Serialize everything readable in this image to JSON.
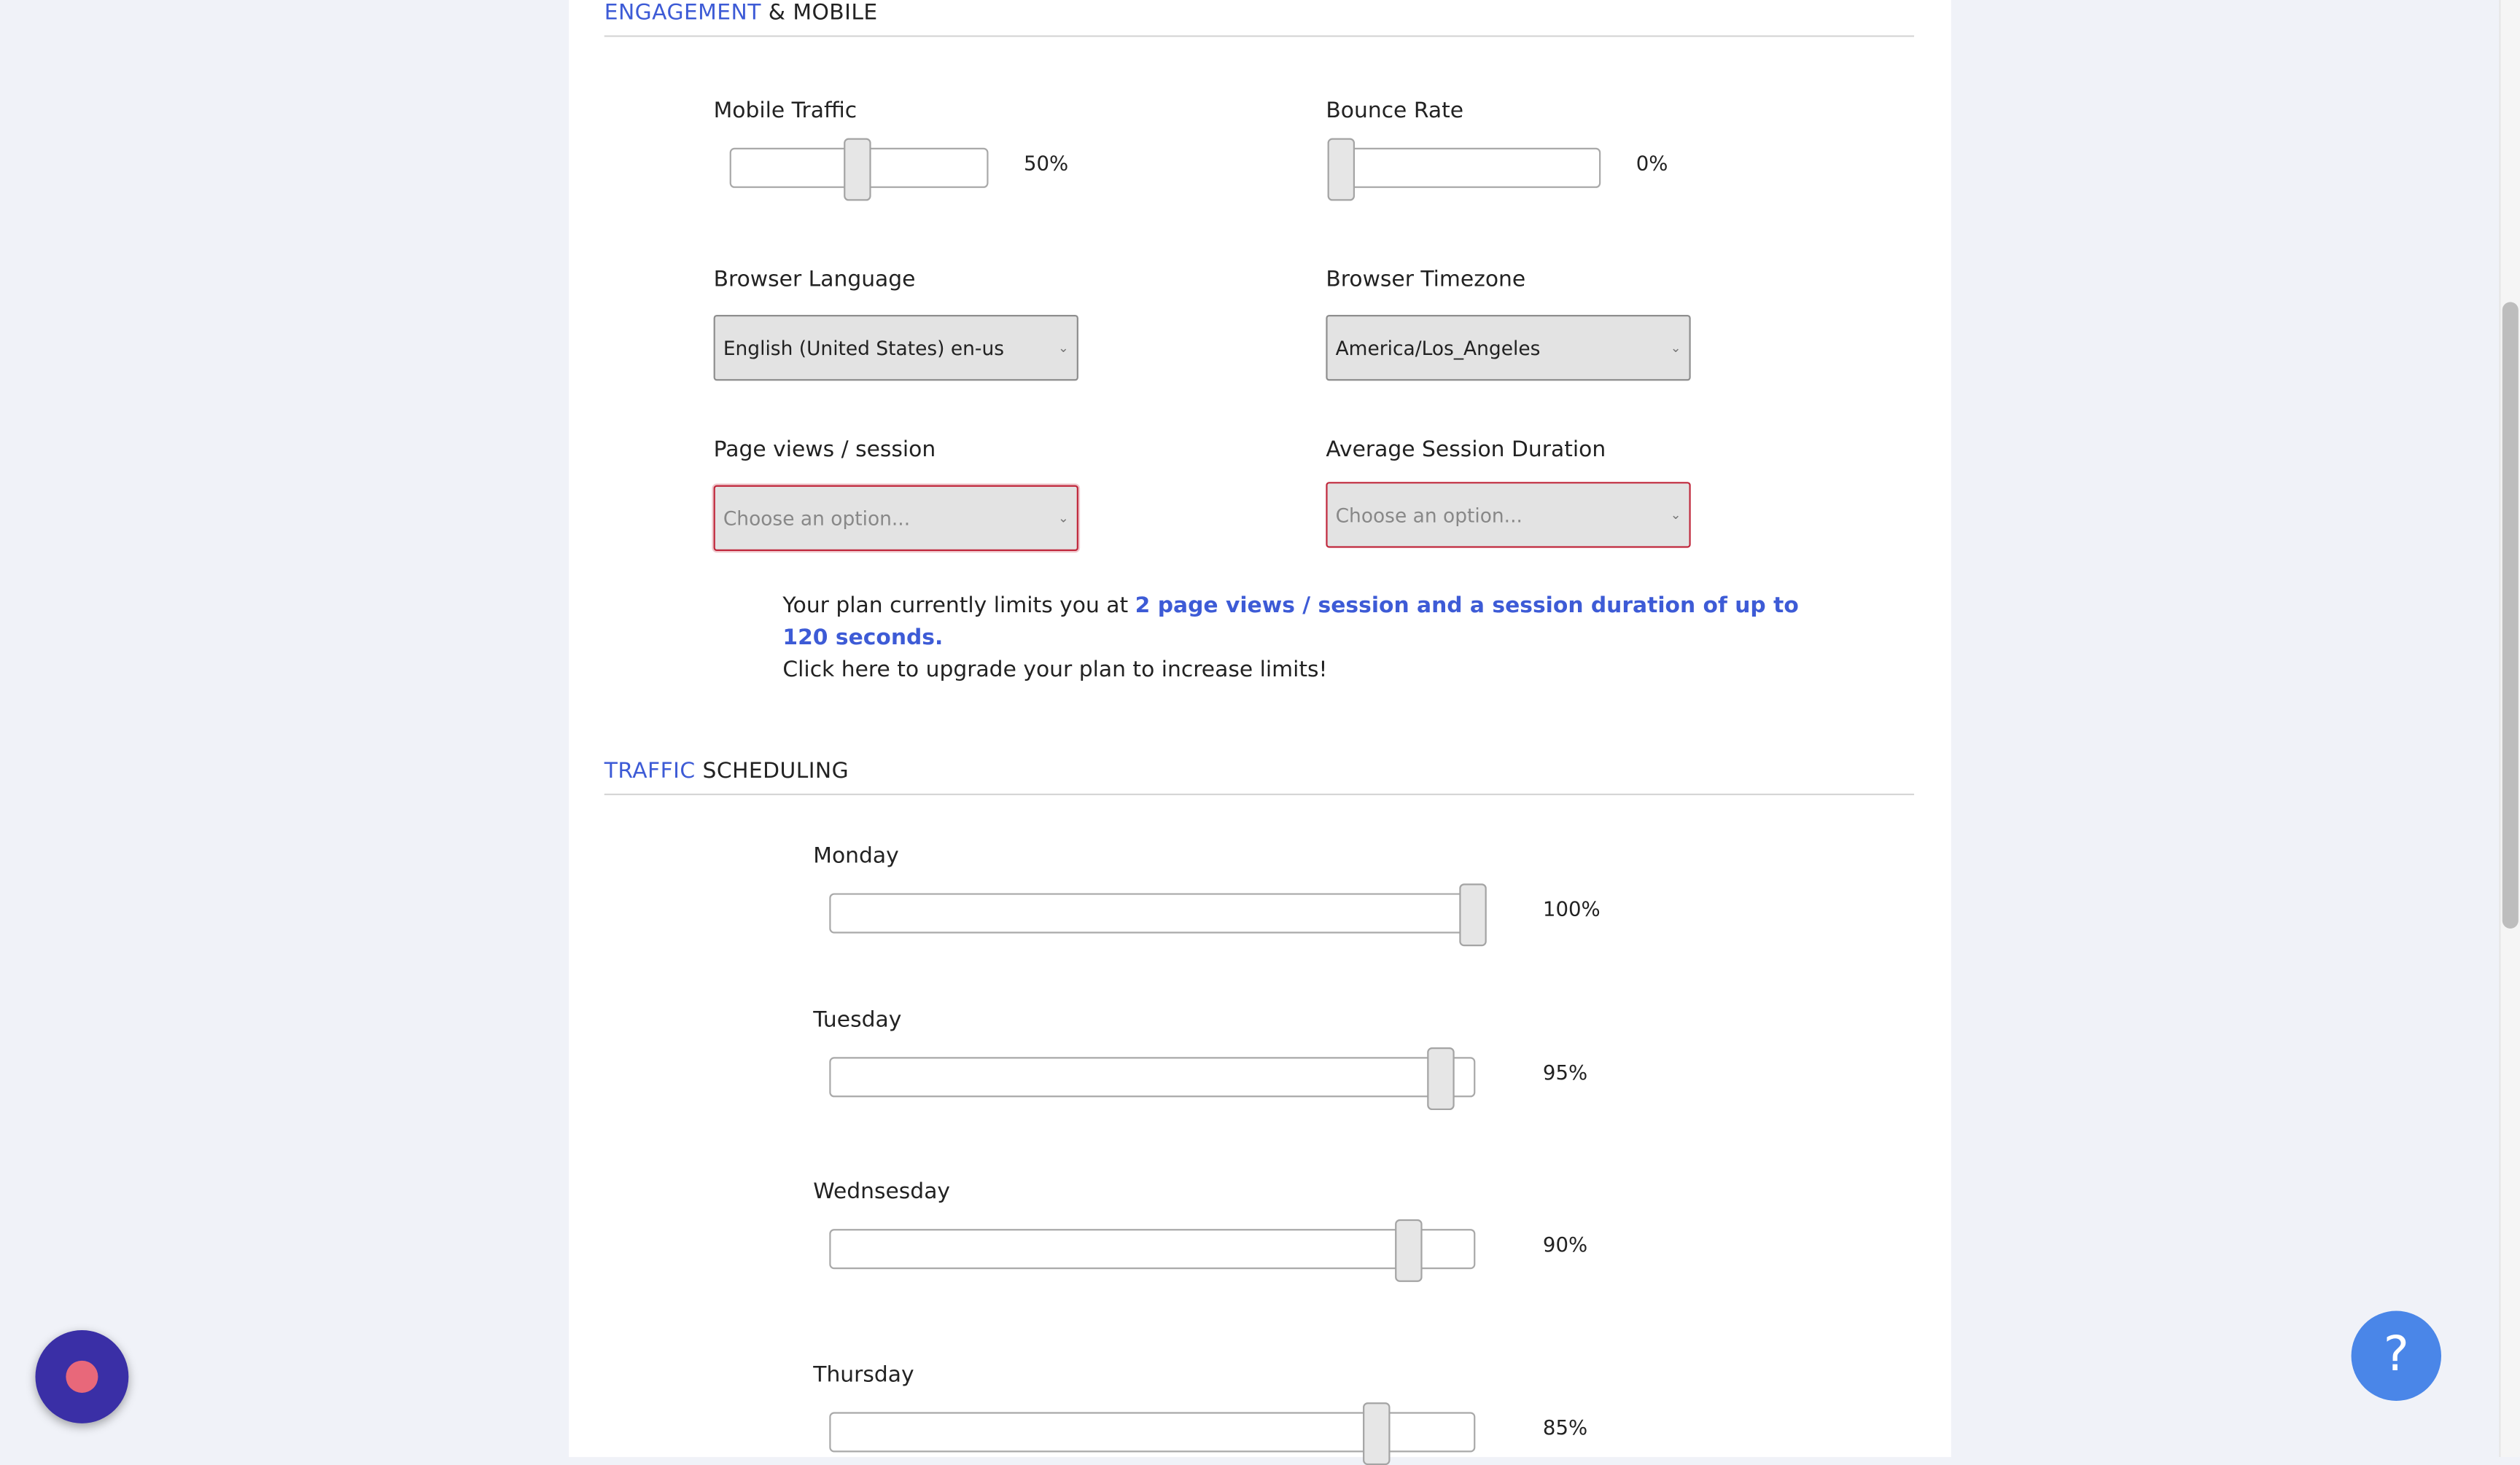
{
  "engagement": {
    "title_accent": "ENGAGEMENT",
    "title_rest": "& MOBILE",
    "mobile_traffic": {
      "label": "Mobile Traffic",
      "value": 0.5,
      "value_text": "50%"
    },
    "bounce_rate": {
      "label": "Bounce Rate",
      "value": 0.0,
      "value_text": "0%"
    },
    "browser_language": {
      "label": "Browser Language",
      "selected": "English (United States) en-us"
    },
    "browser_timezone": {
      "label": "Browser Timezone",
      "selected": "America/Los_Angeles"
    },
    "page_views": {
      "label": "Page views / session",
      "placeholder": "Choose an option..."
    },
    "session_duration": {
      "label": "Average Session Duration",
      "placeholder": "Choose an option..."
    },
    "plan_text_1": "Your plan currently limits you at ",
    "plan_highlight": "2 page views / session and a session duration of up to 120 seconds.",
    "plan_text_2": "Click here to upgrade your plan to increase limits!"
  },
  "scheduling": {
    "title_accent": "TRAFFIC",
    "title_rest": "SCHEDULING",
    "days": [
      {
        "label": "Monday",
        "value": 1.0,
        "value_text": "100%"
      },
      {
        "label": "Tuesday",
        "value": 0.95,
        "value_text": "95%"
      },
      {
        "label": "Wednsesday",
        "value": 0.9,
        "value_text": "90%"
      },
      {
        "label": "Thursday",
        "value": 0.85,
        "value_text": "85%"
      }
    ]
  },
  "colors": {
    "accent": "#3d5bd6",
    "invalid_border": "#c0283c",
    "record_button": "#3a2fa6",
    "record_dot": "#e8687a",
    "help_button": "#4a86e8"
  },
  "icons": {
    "select_arrow": "chevron-down-icon",
    "help": "question-mark-icon",
    "record": "record-icon"
  },
  "help_button": {
    "glyph": "?"
  }
}
